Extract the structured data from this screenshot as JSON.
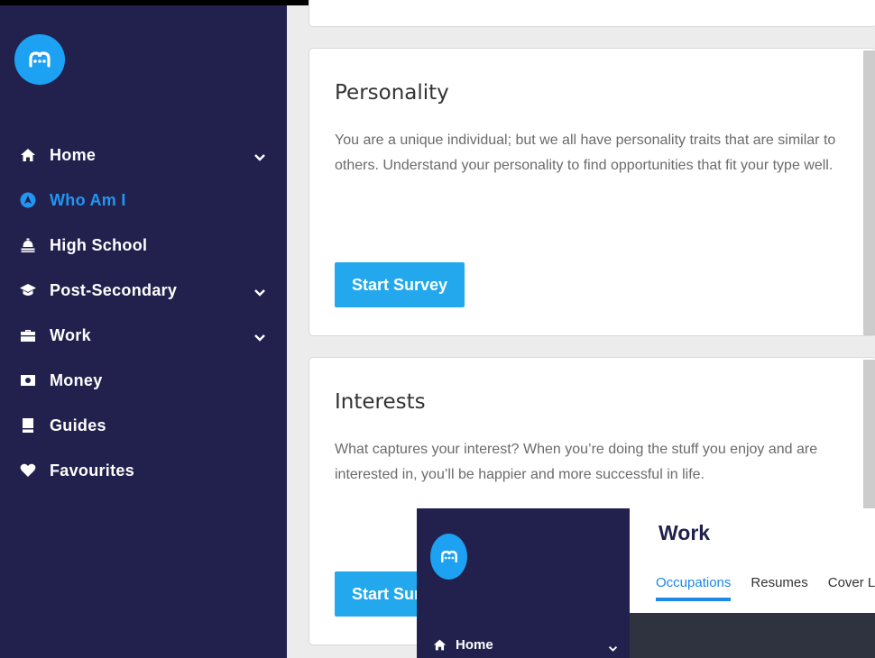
{
  "sidebar": {
    "items": [
      {
        "label": "Home",
        "icon": "home-icon",
        "has_chevron": true
      },
      {
        "label": "Who Am I",
        "icon": "compass-icon",
        "active": true
      },
      {
        "label": "High School",
        "icon": "school-bell-icon"
      },
      {
        "label": "Post-Secondary",
        "icon": "graduation-cap-icon",
        "has_chevron": true
      },
      {
        "label": "Work",
        "icon": "briefcase-icon",
        "has_chevron": true
      },
      {
        "label": "Money",
        "icon": "money-icon"
      },
      {
        "label": "Guides",
        "icon": "book-icon"
      },
      {
        "label": "Favourites",
        "icon": "heart-icon"
      }
    ]
  },
  "cards": {
    "personality": {
      "title": "Personality",
      "description": "You are a unique individual; but we all have personality traits that are similar to others. Understand your personality to find opportunities that fit your type well.",
      "button": "Start Survey"
    },
    "interests": {
      "title": "Interests",
      "description": "What captures your interest? When you’re doing the stuff you enjoy and are interested in, you’ll be happier and more successful in life.",
      "button": "Start Survey"
    }
  },
  "overlay": {
    "title": "Work",
    "home_label": "Home",
    "tabs": [
      "Occupations",
      "Resumes",
      "Cover L"
    ]
  },
  "colors": {
    "sidebar_bg": "#22214d",
    "accent": "#1da1f2",
    "button": "#23a8ee",
    "active_nav": "#2196f3"
  }
}
